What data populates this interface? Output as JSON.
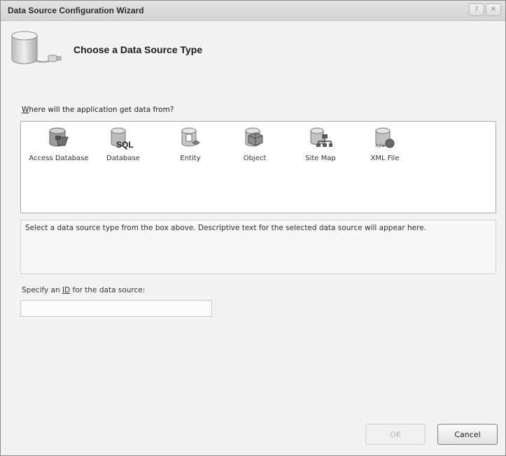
{
  "window": {
    "title": "Data Source Configuration Wizard",
    "controls": {
      "help": "?",
      "close": "✕"
    }
  },
  "header": {
    "title": "Choose a Data Source Type"
  },
  "question": {
    "accelerator": "W",
    "rest": "here will the application get data from?"
  },
  "data_source_types": [
    {
      "label": "Access Database",
      "icon": "access-database-icon"
    },
    {
      "label": "Database",
      "icon": "sql-database-icon"
    },
    {
      "label": "Entity",
      "icon": "entity-icon"
    },
    {
      "label": "Object",
      "icon": "object-icon"
    },
    {
      "label": "Site Map",
      "icon": "site-map-icon"
    },
    {
      "label": "XML File",
      "icon": "xml-file-icon"
    }
  ],
  "description": "Select a data source type from the box above. Descriptive text for the selected data source will appear here.",
  "id_field": {
    "label_before": "Specify an ",
    "label_accelerator": "ID",
    "label_after": " for the data source:",
    "value": ""
  },
  "buttons": {
    "ok": "OK",
    "cancel": "Cancel"
  }
}
